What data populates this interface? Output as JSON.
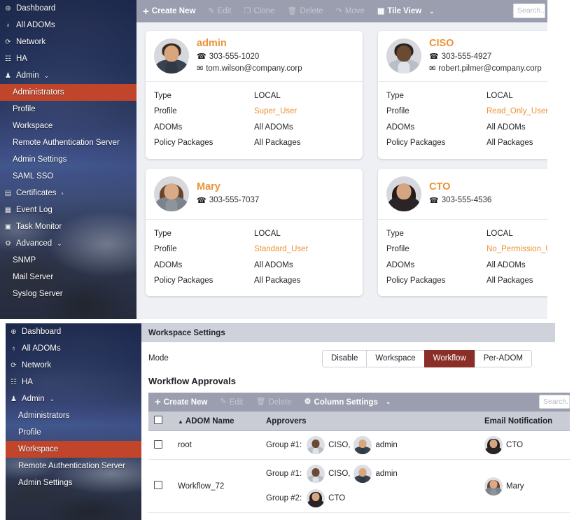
{
  "colors": {
    "sidebar_active": "#c0452b",
    "accent_orange": "#ec9134",
    "toolbar_gray": "#9a9eae",
    "segment_active": "#8a2f28",
    "grid_header": "#c9ccd5"
  },
  "sidebar_top": {
    "items": [
      {
        "label": "Dashboard",
        "icon": "dashboard-icon",
        "glyph": "⊕",
        "sub": false,
        "active": false
      },
      {
        "label": "All ADOMs",
        "icon": "globe-icon",
        "glyph": "♁",
        "sub": false,
        "active": false
      },
      {
        "label": "Network",
        "icon": "network-icon",
        "glyph": "⟳",
        "sub": false,
        "active": false
      },
      {
        "label": "HA",
        "icon": "ha-icon",
        "glyph": "☷",
        "sub": false,
        "active": false
      },
      {
        "label": "Admin",
        "icon": "user-icon",
        "glyph": "♟",
        "sub": false,
        "active": false,
        "caret": "⌄"
      },
      {
        "label": "Administrators",
        "icon": "",
        "glyph": "",
        "sub": true,
        "active": true
      },
      {
        "label": "Profile",
        "icon": "",
        "glyph": "",
        "sub": true,
        "active": false
      },
      {
        "label": "Workspace",
        "icon": "",
        "glyph": "",
        "sub": true,
        "active": false
      },
      {
        "label": "Remote Authentication Server",
        "icon": "",
        "glyph": "",
        "sub": true,
        "active": false
      },
      {
        "label": "Admin Settings",
        "icon": "",
        "glyph": "",
        "sub": true,
        "active": false
      },
      {
        "label": "SAML SSO",
        "icon": "",
        "glyph": "",
        "sub": true,
        "active": false
      },
      {
        "label": "Certificates",
        "icon": "certificate-icon",
        "glyph": "▤",
        "sub": false,
        "active": false,
        "chevron": "›"
      },
      {
        "label": "Event Log",
        "icon": "log-icon",
        "glyph": "▦",
        "sub": false,
        "active": false
      },
      {
        "label": "Task Monitor",
        "icon": "task-icon",
        "glyph": "▣",
        "sub": false,
        "active": false
      },
      {
        "label": "Advanced",
        "icon": "gear-icon",
        "glyph": "⚙",
        "sub": false,
        "active": false,
        "caret": "⌄"
      },
      {
        "label": "SNMP",
        "icon": "",
        "glyph": "",
        "sub": true,
        "active": false
      },
      {
        "label": "Mail Server",
        "icon": "",
        "glyph": "",
        "sub": true,
        "active": false
      },
      {
        "label": "Syslog Server",
        "icon": "",
        "glyph": "",
        "sub": true,
        "active": false
      }
    ]
  },
  "sidebar_bottom": {
    "items": [
      {
        "label": "Dashboard",
        "icon": "dashboard-icon",
        "glyph": "⊕",
        "sub": false,
        "active": false
      },
      {
        "label": "All ADOMs",
        "icon": "globe-icon",
        "glyph": "♁",
        "sub": false,
        "active": false
      },
      {
        "label": "Network",
        "icon": "network-icon",
        "glyph": "⟳",
        "sub": false,
        "active": false
      },
      {
        "label": "HA",
        "icon": "ha-icon",
        "glyph": "☷",
        "sub": false,
        "active": false
      },
      {
        "label": "Admin",
        "icon": "user-icon",
        "glyph": "♟",
        "sub": false,
        "active": false,
        "caret": "⌄"
      },
      {
        "label": "Administrators",
        "icon": "",
        "glyph": "",
        "sub": true,
        "active": false
      },
      {
        "label": "Profile",
        "icon": "",
        "glyph": "",
        "sub": true,
        "active": false
      },
      {
        "label": "Workspace",
        "icon": "",
        "glyph": "",
        "sub": true,
        "active": true
      },
      {
        "label": "Remote Authentication Server",
        "icon": "",
        "glyph": "",
        "sub": true,
        "active": false
      },
      {
        "label": "Admin Settings",
        "icon": "",
        "glyph": "",
        "sub": true,
        "active": false
      }
    ]
  },
  "admin_toolbar": {
    "create_new": "Create New",
    "edit": "Edit",
    "clone": "Clone",
    "delete": "Delete",
    "move": "Move",
    "tile_view": "Tile View",
    "tile_view_caret": "⌄",
    "search_placeholder": "Search..."
  },
  "admin_cards": [
    {
      "name": "admin",
      "phone": "303-555-1020",
      "email": "tom.wilson@company.corp",
      "avatar": "avatar-admin",
      "fields": [
        {
          "key": "Type",
          "value": "LOCAL",
          "accent": false
        },
        {
          "key": "Profile",
          "value": "Super_User",
          "accent": true
        },
        {
          "key": "ADOMs",
          "value": "All ADOMs",
          "accent": false
        },
        {
          "key": "Policy Packages",
          "value": "All Packages",
          "accent": false
        }
      ]
    },
    {
      "name": "CISO",
      "phone": "303-555-4927",
      "email": "robert.pilmer@company.corp",
      "avatar": "avatar-ciso",
      "fields": [
        {
          "key": "Type",
          "value": "LOCAL",
          "accent": false
        },
        {
          "key": "Profile",
          "value": "Read_Only_User",
          "accent": true
        },
        {
          "key": "ADOMs",
          "value": "All ADOMs",
          "accent": false
        },
        {
          "key": "Policy Packages",
          "value": "All Packages",
          "accent": false
        }
      ]
    },
    {
      "name": "Mary",
      "phone": "303-555-7037",
      "email": "",
      "avatar": "avatar-mary",
      "fields": [
        {
          "key": "Type",
          "value": "LOCAL",
          "accent": false
        },
        {
          "key": "Profile",
          "value": "Standard_User",
          "accent": true
        },
        {
          "key": "ADOMs",
          "value": "All ADOMs",
          "accent": false
        },
        {
          "key": "Policy Packages",
          "value": "All Packages",
          "accent": false
        }
      ]
    },
    {
      "name": "CTO",
      "phone": "303-555-4536",
      "email": "",
      "avatar": "avatar-cto",
      "fields": [
        {
          "key": "Type",
          "value": "LOCAL",
          "accent": false
        },
        {
          "key": "Profile",
          "value": "No_Permission_User",
          "accent": true
        },
        {
          "key": "ADOMs",
          "value": "All ADOMs",
          "accent": false
        },
        {
          "key": "Policy Packages",
          "value": "All Packages",
          "accent": false
        }
      ]
    }
  ],
  "workspace": {
    "header_title": "Workspace Settings",
    "mode_label": "Mode",
    "modes": [
      {
        "label": "Disable",
        "selected": false
      },
      {
        "label": "Workspace",
        "selected": false
      },
      {
        "label": "Workflow",
        "selected": true
      },
      {
        "label": "Per-ADOM",
        "selected": false
      }
    ],
    "approvals_title": "Workflow Approvals",
    "grid_toolbar": {
      "create_new": "Create New",
      "edit": "Edit",
      "delete": "Delete",
      "column_settings": "Column Settings",
      "column_settings_caret": "⌄",
      "search_placeholder": "Search..."
    },
    "columns": [
      {
        "label": "",
        "name": "select-all"
      },
      {
        "label": "ADOM Name",
        "name": "adom-name",
        "sort": "▲"
      },
      {
        "label": "Approvers",
        "name": "approvers"
      },
      {
        "label": "Email Notification",
        "name": "email-notification"
      }
    ],
    "rows": [
      {
        "adom_name": "root",
        "groups": [
          {
            "label": "Group #1:",
            "members": [
              {
                "name": "CISO,",
                "avatar": "avatar-ciso"
              },
              {
                "name": "admin",
                "avatar": "avatar-admin"
              }
            ]
          }
        ],
        "notification": {
          "name": "CTO",
          "avatar": "avatar-cto"
        }
      },
      {
        "adom_name": "Workflow_72",
        "groups": [
          {
            "label": "Group #1:",
            "members": [
              {
                "name": "CISO,",
                "avatar": "avatar-ciso"
              },
              {
                "name": "admin",
                "avatar": "avatar-admin"
              }
            ]
          },
          {
            "label": "Group #2:",
            "members": [
              {
                "name": "CTO",
                "avatar": "avatar-cto"
              }
            ]
          }
        ],
        "notification": {
          "name": "Mary",
          "avatar": "avatar-mary"
        }
      }
    ]
  }
}
